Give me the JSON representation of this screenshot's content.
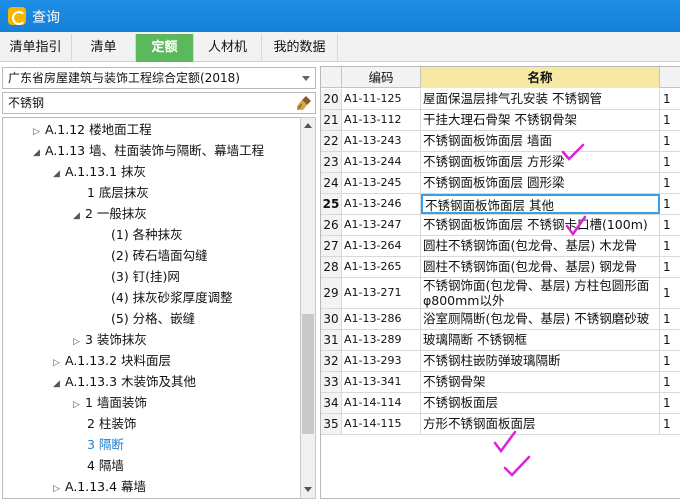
{
  "window": {
    "title": "查询"
  },
  "tabs": [
    {
      "label": "清单指引",
      "active": false
    },
    {
      "label": "清单",
      "active": false
    },
    {
      "label": "定额",
      "active": true
    },
    {
      "label": "人材机",
      "active": false
    },
    {
      "label": "我的数据",
      "active": false
    }
  ],
  "left": {
    "norm_selected": "广东省房屋建筑与装饰工程综合定额(2018)",
    "search_value": "不锈钢",
    "tree": [
      {
        "arrow": "▷",
        "label": "A.1.12 楼地面工程"
      },
      {
        "arrow": "◢",
        "label": "A.1.13 墙、柱面装饰与隔断、幕墙工程"
      },
      {
        "arrow": "◢",
        "label": "A.1.13.1 抹灰"
      },
      {
        "arrow": "",
        "label": "1 底层抹灰"
      },
      {
        "arrow": "◢",
        "label": "2 一般抹灰"
      },
      {
        "arrow": "",
        "label": "(1) 各种抹灰"
      },
      {
        "arrow": "",
        "label": "(2) 砖石墙面勾缝"
      },
      {
        "arrow": "",
        "label": "(3) 钉(挂)网"
      },
      {
        "arrow": "",
        "label": "(4) 抹灰砂浆厚度调整"
      },
      {
        "arrow": "",
        "label": "(5) 分格、嵌缝"
      },
      {
        "arrow": "▷",
        "label": "3 装饰抹灰"
      },
      {
        "arrow": "▷",
        "label": "A.1.13.2 块料面层"
      },
      {
        "arrow": "◢",
        "label": "A.1.13.3 木装饰及其他"
      },
      {
        "arrow": "▷",
        "label": "1 墙面装饰"
      },
      {
        "arrow": "",
        "label": "2 柱装饰"
      },
      {
        "arrow": "",
        "label": "3 隔断",
        "selected": true
      },
      {
        "arrow": "",
        "label": "4 隔墙"
      },
      {
        "arrow": "▷",
        "label": "A.1.13.4 幕墙"
      }
    ]
  },
  "grid": {
    "headers": {
      "code": "编码",
      "name": "名称"
    },
    "rows": [
      {
        "num": "20",
        "code": "A1-11-125",
        "name": "屋面保温层排气孔安装 不锈钢管",
        "extra": "1"
      },
      {
        "num": "21",
        "code": "A1-13-112",
        "name": "干挂大理石骨架 不锈钢骨架",
        "extra": "1"
      },
      {
        "num": "22",
        "code": "A1-13-243",
        "name": "不锈钢面板饰面层 墙面",
        "extra": "1"
      },
      {
        "num": "23",
        "code": "A1-13-244",
        "name": "不锈钢面板饰面层 方形梁",
        "extra": "1"
      },
      {
        "num": "24",
        "code": "A1-13-245",
        "name": "不锈钢面板饰面层 圆形梁",
        "extra": "1"
      },
      {
        "num": "25",
        "code": "A1-13-246",
        "name": "不锈钢面板饰面层 其他",
        "extra": "1",
        "current": true
      },
      {
        "num": "26",
        "code": "A1-13-247",
        "name": "不锈钢面板饰面层 不锈钢卡口槽(100m)",
        "extra": "1"
      },
      {
        "num": "27",
        "code": "A1-13-264",
        "name": "圆柱不锈钢饰面(包龙骨、基层) 木龙骨",
        "extra": "1"
      },
      {
        "num": "28",
        "code": "A1-13-265",
        "name": "圆柱不锈钢饰面(包龙骨、基层) 钢龙骨",
        "extra": "1"
      },
      {
        "num": "29",
        "code": "A1-13-271",
        "name": "不锈钢饰面(包龙骨、基层) 方柱包圆形面 φ800mm以外",
        "extra": "1",
        "tall": true
      },
      {
        "num": "30",
        "code": "A1-13-286",
        "name": "浴室厕隔断(包龙骨、基层) 不锈钢磨砂玻璃",
        "extra": "1"
      },
      {
        "num": "31",
        "code": "A1-13-289",
        "name": "玻璃隔断 不锈钢框",
        "extra": "1"
      },
      {
        "num": "32",
        "code": "A1-13-293",
        "name": "不锈钢柱嵌防弹玻璃隔断",
        "extra": "1"
      },
      {
        "num": "33",
        "code": "A1-13-341",
        "name": "不锈钢骨架",
        "extra": "1"
      },
      {
        "num": "34",
        "code": "A1-14-114",
        "name": "不锈钢板面层",
        "extra": "1"
      },
      {
        "num": "35",
        "code": "A1-14-115",
        "name": "方形不锈钢面板面层",
        "extra": "1"
      }
    ]
  },
  "colors": {
    "titlebar": "#1f8ee6",
    "active_tab": "#5cb85c",
    "name_header": "#f5e9a3",
    "checkmark": "#e020d8",
    "current_row_border": "#3a9de8"
  },
  "icons": [
    "app-icon",
    "brush-icon",
    "checkmark-icon"
  ]
}
